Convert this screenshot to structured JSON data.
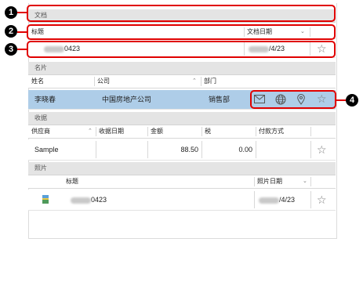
{
  "callouts": [
    "1",
    "2",
    "3",
    "4"
  ],
  "documents": {
    "section_title": "文档",
    "col_title": "标题",
    "col_date": "文档日期",
    "row": {
      "title_suffix": "0423",
      "date_suffix": "/4/23"
    }
  },
  "business_cards": {
    "section_title": "名片",
    "col_name": "姓名",
    "col_company": "公司",
    "col_department": "部门",
    "row": {
      "name": "李晓春",
      "company": "中国房地产公司",
      "department": "销售部"
    },
    "actions": [
      "mail-icon",
      "globe-icon",
      "map-pin-icon",
      "star-icon"
    ]
  },
  "receipts": {
    "section_title": "收据",
    "col_vendor": "供应商",
    "col_date": "收据日期",
    "col_amount": "金额",
    "col_tax": "税",
    "col_payment": "付款方式",
    "row": {
      "vendor": "Sample",
      "amount": "88.50",
      "tax": "0.00"
    }
  },
  "photos": {
    "section_title": "照片",
    "col_title": "标题",
    "col_date": "照片日期",
    "row": {
      "title_suffix": "0423",
      "date_suffix": "/4/23"
    }
  },
  "colors": {
    "highlight": "#e00000",
    "selected_row": "#aecde8",
    "section_bg": "#e4e4e4"
  }
}
